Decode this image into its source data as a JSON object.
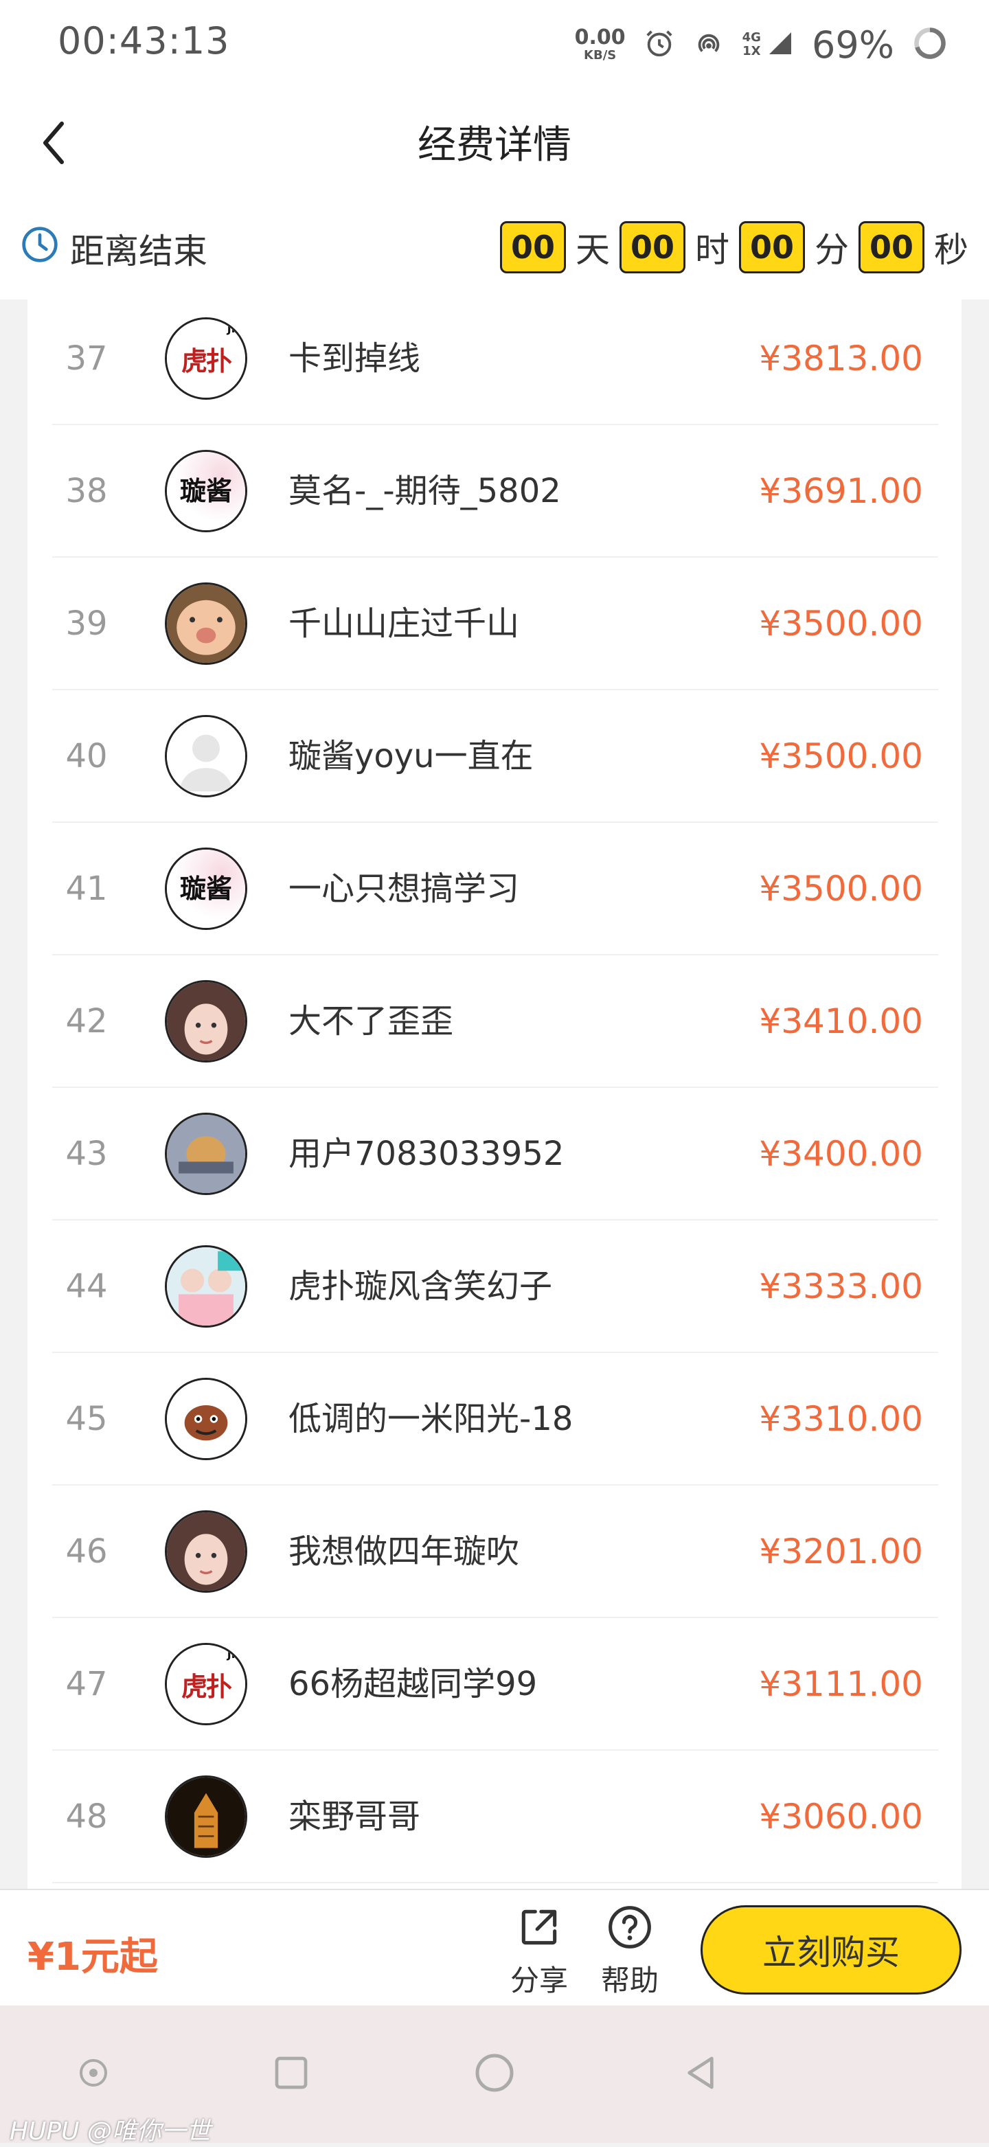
{
  "status_bar": {
    "time": "00:43:13",
    "net_speed": "0.00",
    "net_unit": "KB/S",
    "net_type_top": "4G",
    "net_type_bottom": "1X",
    "battery": "69%"
  },
  "header": {
    "title": "经费详情"
  },
  "countdown": {
    "label": "距离结束",
    "days": "00",
    "days_unit": "天",
    "hours": "00",
    "hours_unit": "时",
    "minutes": "00",
    "minutes_unit": "分",
    "seconds": "00",
    "seconds_unit": "秒"
  },
  "list": [
    {
      "rank": "37",
      "name": "卡到掉线",
      "amount": "¥3813.00",
      "avatar": "hupu-logo"
    },
    {
      "rank": "38",
      "name": "莫名-_-期待_5802",
      "amount": "¥3691.00",
      "avatar": "xuanjiang-logo"
    },
    {
      "rank": "39",
      "name": "千山山庄过千山",
      "amount": "¥3500.00",
      "avatar": "photo-face"
    },
    {
      "rank": "40",
      "name": "璇酱yoyu一直在",
      "amount": "¥3500.00",
      "avatar": "default-user"
    },
    {
      "rank": "41",
      "name": "一心只想搞学习",
      "amount": "¥3500.00",
      "avatar": "xuanjiang-logo"
    },
    {
      "rank": "42",
      "name": "大不了歪歪",
      "amount": "¥3410.00",
      "avatar": "photo-girl"
    },
    {
      "rank": "43",
      "name": "用户7083033952",
      "amount": "¥3400.00",
      "avatar": "photo-toy"
    },
    {
      "rank": "44",
      "name": "虎扑璇风含笑幻子",
      "amount": "¥3333.00",
      "avatar": "photo-group"
    },
    {
      "rank": "45",
      "name": "低调的一米阳光-18",
      "amount": "¥3310.00",
      "avatar": "cartoon-dog"
    },
    {
      "rank": "46",
      "name": "我想做四年璇吹",
      "amount": "¥3201.00",
      "avatar": "photo-girl"
    },
    {
      "rank": "47",
      "name": "66杨超越同学99",
      "amount": "¥3111.00",
      "avatar": "hupu-logo"
    },
    {
      "rank": "48",
      "name": "栾野哥哥",
      "amount": "¥3060.00",
      "avatar": "photo-tower"
    }
  ],
  "avatar_texts": {
    "hupu": "虎扑",
    "hupu_badge": "JR",
    "xuanjiang": "璇酱"
  },
  "action_bar": {
    "price_start": "¥1元起",
    "share_label": "分享",
    "help_label": "帮助",
    "buy_label": "立刻购买"
  },
  "watermark": "HUPU @唯你一世",
  "colors": {
    "accent": "#ffd715",
    "price": "#f06a3b"
  }
}
